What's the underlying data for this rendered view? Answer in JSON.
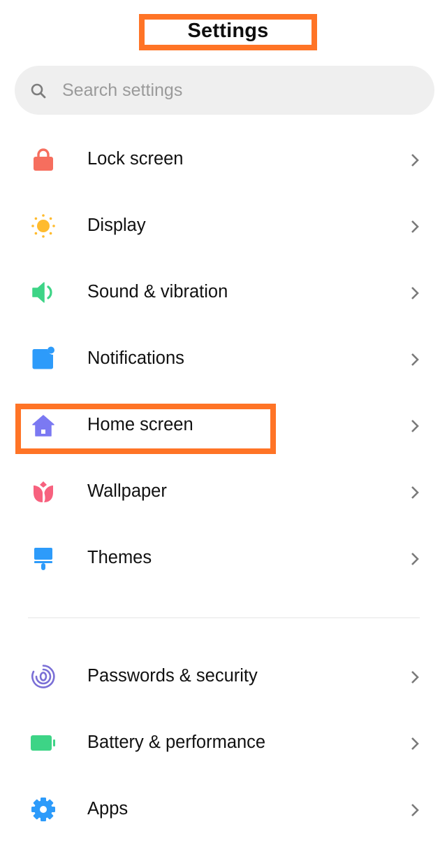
{
  "header": {
    "title": "Settings"
  },
  "search": {
    "placeholder": "Search settings",
    "value": ""
  },
  "sections": [
    {
      "items": [
        {
          "label": "Lock screen",
          "icon": "lock-icon",
          "color": "#f66e5e"
        },
        {
          "label": "Display",
          "icon": "sun-icon",
          "color": "#ffbb2e"
        },
        {
          "label": "Sound & vibration",
          "icon": "speaker-icon",
          "color": "#3dd486"
        },
        {
          "label": "Notifications",
          "icon": "notification-icon",
          "color": "#2d9bfa"
        },
        {
          "label": "Home screen",
          "icon": "home-icon",
          "color": "#7b79f2",
          "highlighted": true
        },
        {
          "label": "Wallpaper",
          "icon": "tulip-icon",
          "color": "#f7617e"
        },
        {
          "label": "Themes",
          "icon": "paintbrush-icon",
          "color": "#2d9bfa"
        }
      ]
    },
    {
      "items": [
        {
          "label": "Passwords & security",
          "icon": "fingerprint-icon",
          "color": "#7a6fd6"
        },
        {
          "label": "Battery & performance",
          "icon": "battery-icon",
          "color": "#3dd486"
        },
        {
          "label": "Apps",
          "icon": "gear-icon",
          "color": "#2d9bfa"
        }
      ]
    }
  ],
  "annotation_color": "#ff7426"
}
